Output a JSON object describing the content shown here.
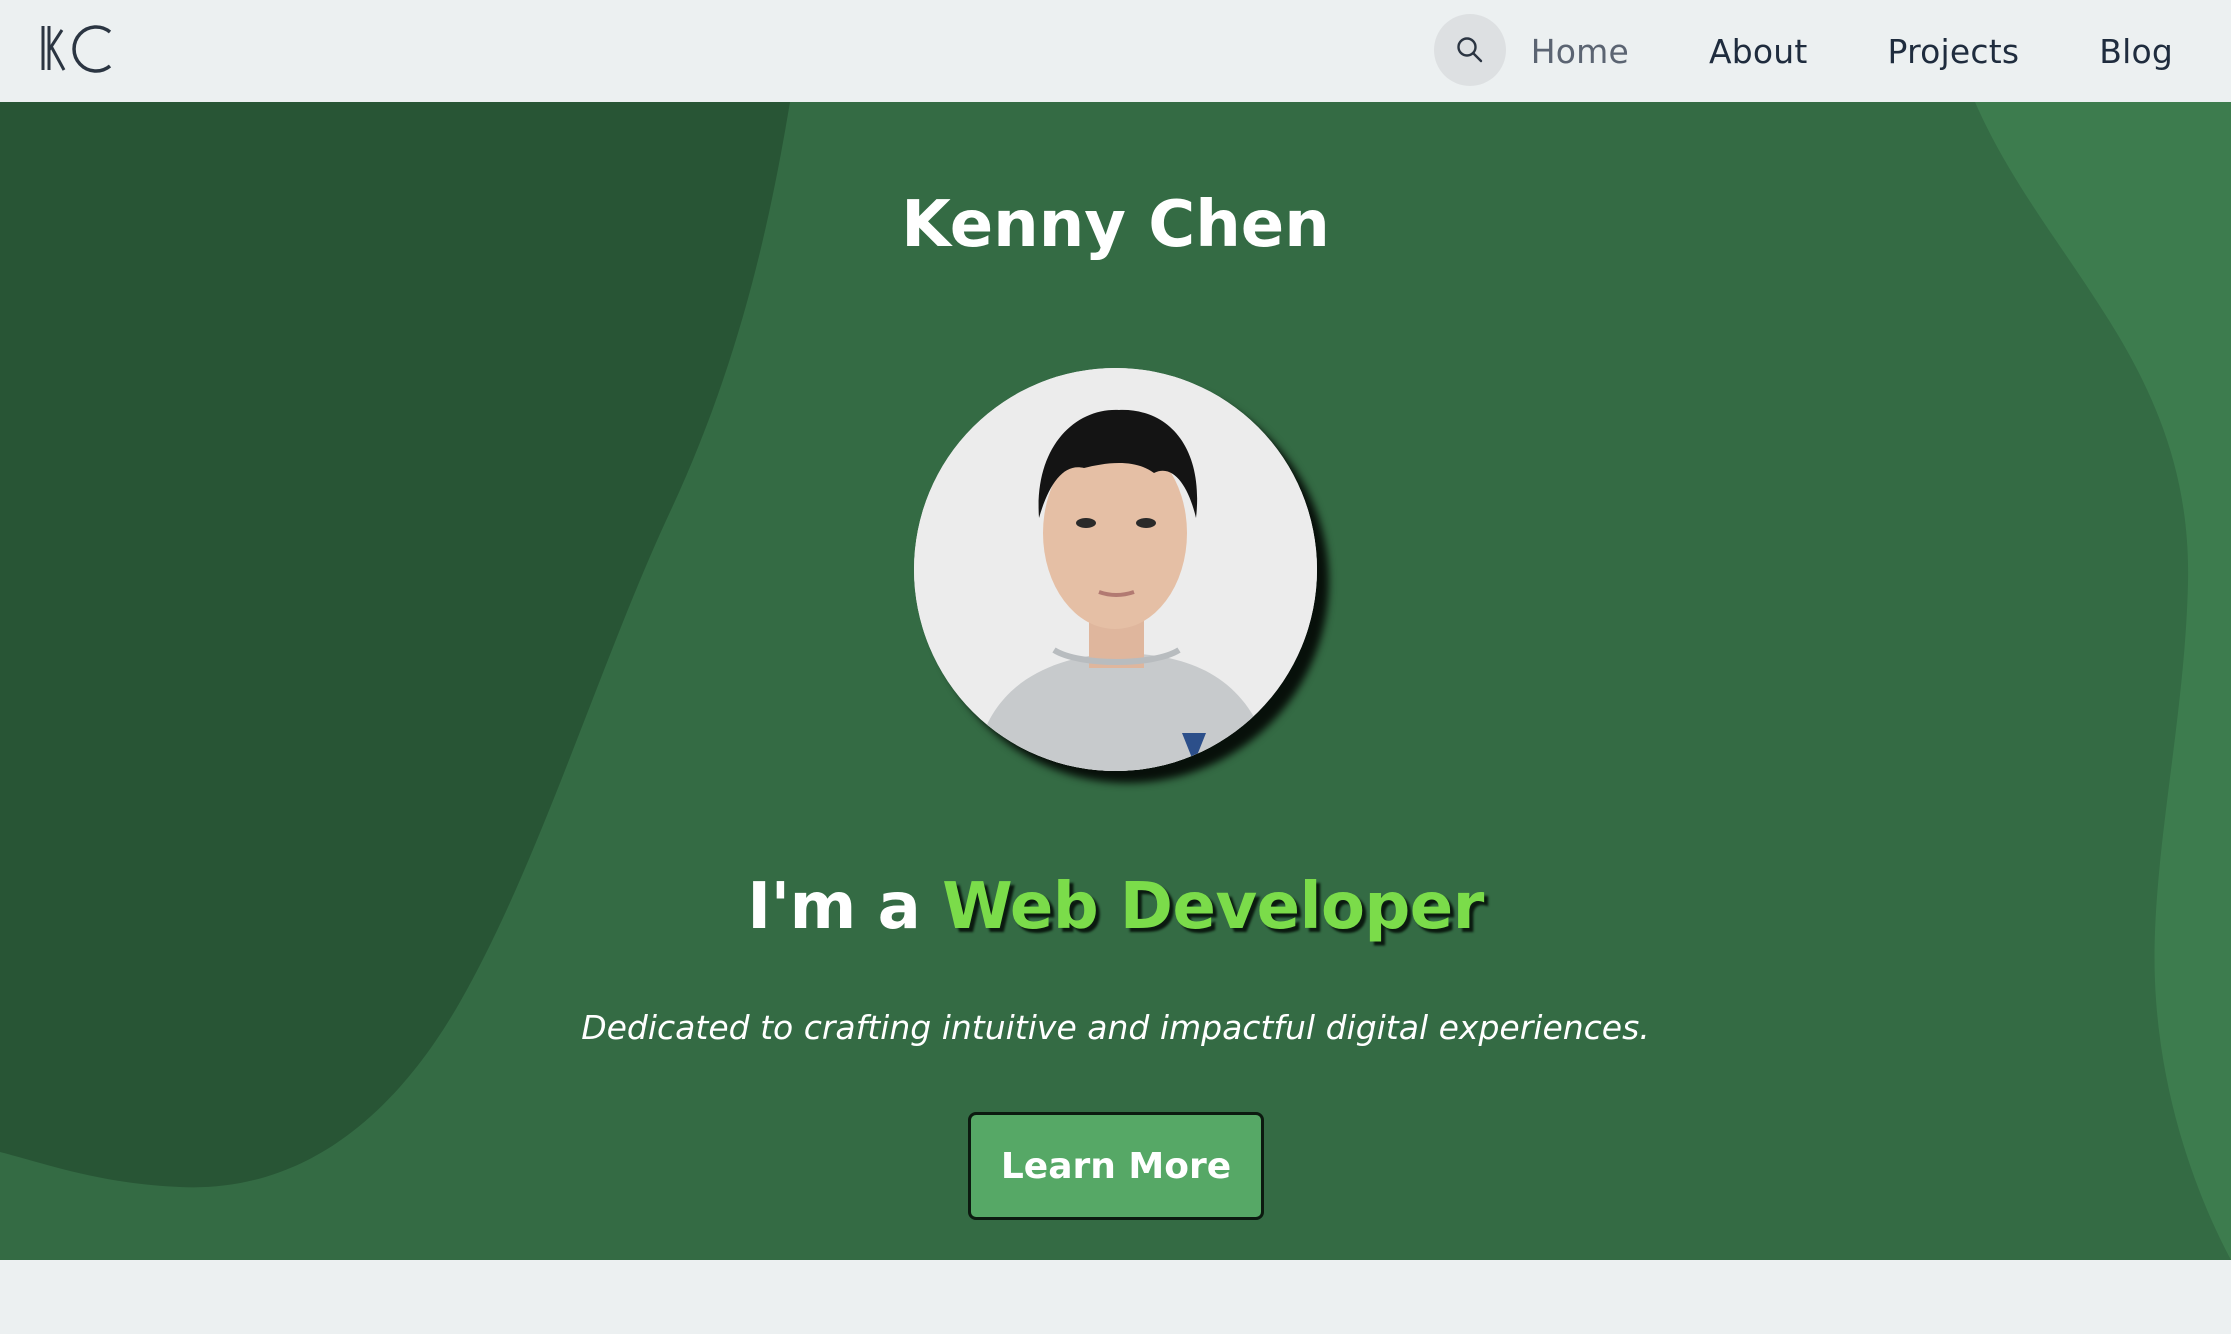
{
  "nav": {
    "logo_text": "KC",
    "links": [
      {
        "label": "Home",
        "active": true
      },
      {
        "label": "About",
        "active": false
      },
      {
        "label": "Projects",
        "active": false
      },
      {
        "label": "Blog",
        "active": false
      }
    ],
    "search_icon": "search-icon"
  },
  "hero": {
    "name": "Kenny Chen",
    "tagline_prefix": "I'm a ",
    "tagline_role": "Web Developer",
    "subtitle": "Dedicated to crafting intuitive and impactful digital experiences.",
    "cta_label": "Learn More"
  },
  "colors": {
    "nav_bg": "#ecf0f1",
    "hero_bg": "#346b44",
    "hero_blob_dark": "#285535",
    "hero_blob_light": "#3d7c4e",
    "accent_green": "#7bdc4a",
    "button_bg": "#56a866",
    "nav_text": "#1f2c3e"
  }
}
